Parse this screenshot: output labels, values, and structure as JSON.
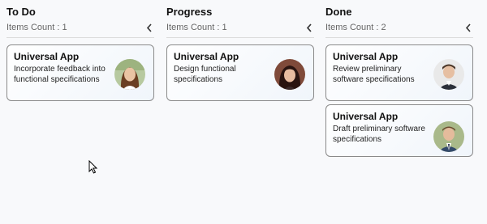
{
  "columns": [
    {
      "title": "To Do",
      "count_text": "Items Count : 1",
      "collapse_icon": "chevron-left-icon",
      "cards": [
        {
          "title": "Universal App",
          "description": "Incorporate feedback into functional specifications",
          "avatar": "woman-long-brown-hair"
        }
      ]
    },
    {
      "title": "Progress",
      "count_text": "Items Count : 1",
      "collapse_icon": "chevron-left-icon",
      "cards": [
        {
          "title": "Universal App",
          "description": "Design functional specifications",
          "avatar": "woman-dark-hair-bangs"
        }
      ]
    },
    {
      "title": "Done",
      "count_text": "Items Count : 2",
      "collapse_icon": "chevron-left-icon",
      "cards": [
        {
          "title": "Universal App",
          "description": "Review preliminary software specifications",
          "avatar": "man-suit"
        },
        {
          "title": "Universal App",
          "description": "Draft preliminary software specifications",
          "avatar": "man-suit-tie"
        }
      ]
    }
  ],
  "colors": {
    "background": "#f8f9fb",
    "card_border": "#8a8a8a",
    "divider": "#dcdcdc",
    "muted_text": "#666666"
  }
}
